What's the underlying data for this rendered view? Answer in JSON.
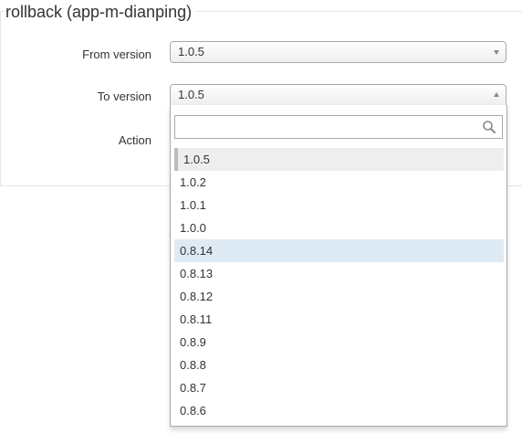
{
  "page": {
    "title": "rollback (app-m-dianping)"
  },
  "form": {
    "from_label": "From version",
    "to_label": "To version",
    "action_label": "Action",
    "from_value": "1.0.5",
    "to_value": "1.0.5"
  },
  "dropdown": {
    "search_placeholder": "",
    "selected_index": 0,
    "highlighted_index": 4,
    "options": [
      "1.0.5",
      "1.0.2",
      "1.0.1",
      "1.0.0",
      "0.8.14",
      "0.8.13",
      "0.8.12",
      "0.8.11",
      "0.8.9",
      "0.8.8",
      "0.8.7",
      "0.8.6"
    ]
  },
  "colors": {
    "highlight": "#deebf4",
    "selected": "#eeeeee",
    "border": "#aaaaaa"
  }
}
